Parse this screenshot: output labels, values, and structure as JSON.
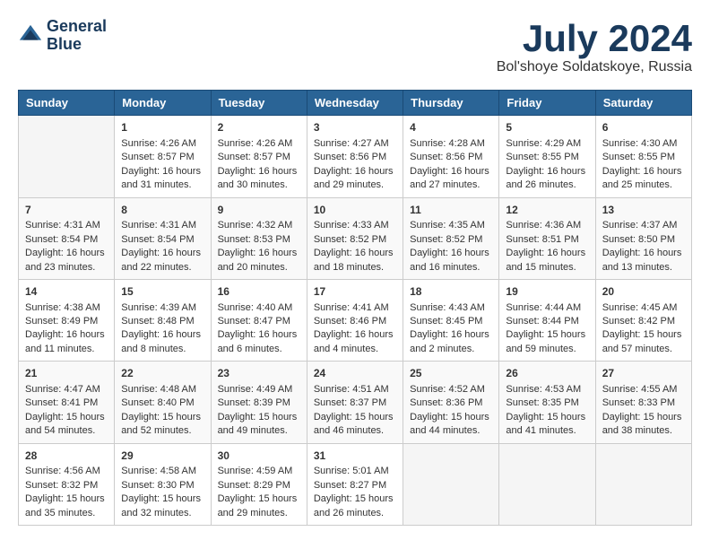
{
  "header": {
    "logo_line1": "General",
    "logo_line2": "Blue",
    "month_year": "July 2024",
    "location": "Bol'shoye Soldatskoye, Russia"
  },
  "days_of_week": [
    "Sunday",
    "Monday",
    "Tuesday",
    "Wednesday",
    "Thursday",
    "Friday",
    "Saturday"
  ],
  "weeks": [
    [
      {
        "day": "",
        "content": ""
      },
      {
        "day": "1",
        "content": "Sunrise: 4:26 AM\nSunset: 8:57 PM\nDaylight: 16 hours\nand 31 minutes."
      },
      {
        "day": "2",
        "content": "Sunrise: 4:26 AM\nSunset: 8:57 PM\nDaylight: 16 hours\nand 30 minutes."
      },
      {
        "day": "3",
        "content": "Sunrise: 4:27 AM\nSunset: 8:56 PM\nDaylight: 16 hours\nand 29 minutes."
      },
      {
        "day": "4",
        "content": "Sunrise: 4:28 AM\nSunset: 8:56 PM\nDaylight: 16 hours\nand 27 minutes."
      },
      {
        "day": "5",
        "content": "Sunrise: 4:29 AM\nSunset: 8:55 PM\nDaylight: 16 hours\nand 26 minutes."
      },
      {
        "day": "6",
        "content": "Sunrise: 4:30 AM\nSunset: 8:55 PM\nDaylight: 16 hours\nand 25 minutes."
      }
    ],
    [
      {
        "day": "7",
        "content": "Sunrise: 4:31 AM\nSunset: 8:54 PM\nDaylight: 16 hours\nand 23 minutes."
      },
      {
        "day": "8",
        "content": "Sunrise: 4:31 AM\nSunset: 8:54 PM\nDaylight: 16 hours\nand 22 minutes."
      },
      {
        "day": "9",
        "content": "Sunrise: 4:32 AM\nSunset: 8:53 PM\nDaylight: 16 hours\nand 20 minutes."
      },
      {
        "day": "10",
        "content": "Sunrise: 4:33 AM\nSunset: 8:52 PM\nDaylight: 16 hours\nand 18 minutes."
      },
      {
        "day": "11",
        "content": "Sunrise: 4:35 AM\nSunset: 8:52 PM\nDaylight: 16 hours\nand 16 minutes."
      },
      {
        "day": "12",
        "content": "Sunrise: 4:36 AM\nSunset: 8:51 PM\nDaylight: 16 hours\nand 15 minutes."
      },
      {
        "day": "13",
        "content": "Sunrise: 4:37 AM\nSunset: 8:50 PM\nDaylight: 16 hours\nand 13 minutes."
      }
    ],
    [
      {
        "day": "14",
        "content": "Sunrise: 4:38 AM\nSunset: 8:49 PM\nDaylight: 16 hours\nand 11 minutes."
      },
      {
        "day": "15",
        "content": "Sunrise: 4:39 AM\nSunset: 8:48 PM\nDaylight: 16 hours\nand 8 minutes."
      },
      {
        "day": "16",
        "content": "Sunrise: 4:40 AM\nSunset: 8:47 PM\nDaylight: 16 hours\nand 6 minutes."
      },
      {
        "day": "17",
        "content": "Sunrise: 4:41 AM\nSunset: 8:46 PM\nDaylight: 16 hours\nand 4 minutes."
      },
      {
        "day": "18",
        "content": "Sunrise: 4:43 AM\nSunset: 8:45 PM\nDaylight: 16 hours\nand 2 minutes."
      },
      {
        "day": "19",
        "content": "Sunrise: 4:44 AM\nSunset: 8:44 PM\nDaylight: 15 hours\nand 59 minutes."
      },
      {
        "day": "20",
        "content": "Sunrise: 4:45 AM\nSunset: 8:42 PM\nDaylight: 15 hours\nand 57 minutes."
      }
    ],
    [
      {
        "day": "21",
        "content": "Sunrise: 4:47 AM\nSunset: 8:41 PM\nDaylight: 15 hours\nand 54 minutes."
      },
      {
        "day": "22",
        "content": "Sunrise: 4:48 AM\nSunset: 8:40 PM\nDaylight: 15 hours\nand 52 minutes."
      },
      {
        "day": "23",
        "content": "Sunrise: 4:49 AM\nSunset: 8:39 PM\nDaylight: 15 hours\nand 49 minutes."
      },
      {
        "day": "24",
        "content": "Sunrise: 4:51 AM\nSunset: 8:37 PM\nDaylight: 15 hours\nand 46 minutes."
      },
      {
        "day": "25",
        "content": "Sunrise: 4:52 AM\nSunset: 8:36 PM\nDaylight: 15 hours\nand 44 minutes."
      },
      {
        "day": "26",
        "content": "Sunrise: 4:53 AM\nSunset: 8:35 PM\nDaylight: 15 hours\nand 41 minutes."
      },
      {
        "day": "27",
        "content": "Sunrise: 4:55 AM\nSunset: 8:33 PM\nDaylight: 15 hours\nand 38 minutes."
      }
    ],
    [
      {
        "day": "28",
        "content": "Sunrise: 4:56 AM\nSunset: 8:32 PM\nDaylight: 15 hours\nand 35 minutes."
      },
      {
        "day": "29",
        "content": "Sunrise: 4:58 AM\nSunset: 8:30 PM\nDaylight: 15 hours\nand 32 minutes."
      },
      {
        "day": "30",
        "content": "Sunrise: 4:59 AM\nSunset: 8:29 PM\nDaylight: 15 hours\nand 29 minutes."
      },
      {
        "day": "31",
        "content": "Sunrise: 5:01 AM\nSunset: 8:27 PM\nDaylight: 15 hours\nand 26 minutes."
      },
      {
        "day": "",
        "content": ""
      },
      {
        "day": "",
        "content": ""
      },
      {
        "day": "",
        "content": ""
      }
    ]
  ]
}
